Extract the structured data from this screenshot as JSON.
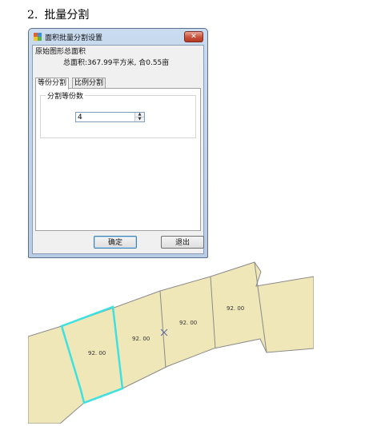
{
  "heading": {
    "number": "2.",
    "text": "批量分割"
  },
  "dialog": {
    "title": "面积批量分割设置",
    "close_glyph": "✕",
    "group_label": "原始图形总面积",
    "total_area": "总面积:367.99平方米, 合0.55亩",
    "tabs": [
      {
        "label": "等份分割",
        "active": true
      },
      {
        "label": "比例分割",
        "active": false
      }
    ],
    "panel": {
      "legend": "分割等份数",
      "value": "4"
    },
    "ok_label": "确定",
    "cancel_label": "退出"
  },
  "map": {
    "parcels": [
      {
        "label": "92. 00",
        "selected": true
      },
      {
        "label": "92. 00",
        "selected": false
      },
      {
        "label": "92. 00",
        "selected": false
      },
      {
        "label": "92. 00",
        "selected": false
      }
    ],
    "fill_color": "#efe7b8",
    "stroke_color": "#8a8a8a",
    "highlight_color": "#3fe0e0"
  }
}
